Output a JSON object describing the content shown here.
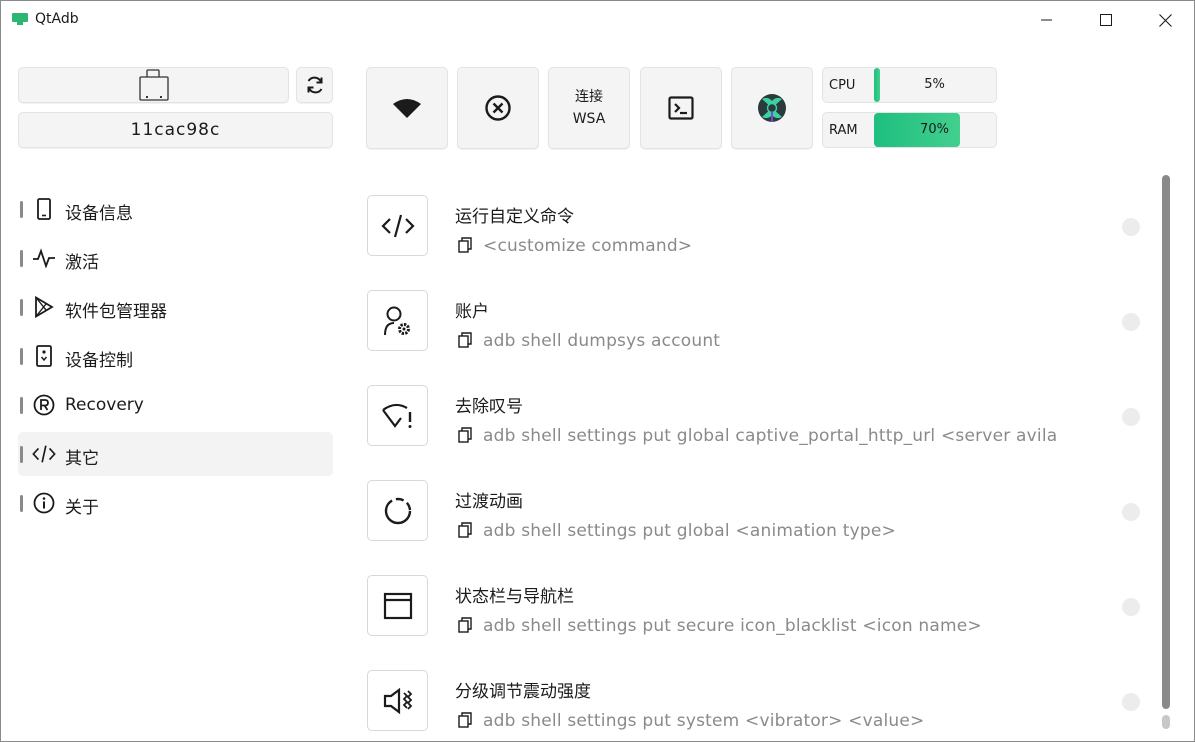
{
  "app": {
    "title": "QtAdb"
  },
  "device": {
    "serial": "11cac98c"
  },
  "toolbar": {
    "wsa_label": "连接\nWSA"
  },
  "meters": {
    "cpu": {
      "label": "CPU",
      "value_text": "5%",
      "value": 0.05
    },
    "ram": {
      "label": "RAM",
      "value_text": "70%",
      "value": 0.7
    }
  },
  "sidebar": {
    "items": [
      {
        "label": "设备信息",
        "icon": "phone-icon"
      },
      {
        "label": "激活",
        "icon": "pulse-icon"
      },
      {
        "label": "软件包管理器",
        "icon": "play-store-icon"
      },
      {
        "label": "设备控制",
        "icon": "remote-icon"
      },
      {
        "label": "Recovery",
        "icon": "registered-icon"
      },
      {
        "label": "其它",
        "icon": "code-icon",
        "active": true
      },
      {
        "label": "关于",
        "icon": "info-icon"
      }
    ]
  },
  "commands": [
    {
      "title": "运行自定义命令",
      "command": "<customize command>",
      "icon": "code-icon"
    },
    {
      "title": "账户",
      "command": "adb shell dumpsys account",
      "icon": "user-settings-icon"
    },
    {
      "title": "去除叹号",
      "command": "adb shell settings put global captive_portal_http_url <server avila",
      "icon": "wifi-warning-icon"
    },
    {
      "title": "过渡动画",
      "command": "adb shell settings put global <animation type>",
      "icon": "loading-circle-icon"
    },
    {
      "title": "状态栏与导航栏",
      "command": "adb shell settings put secure icon_blacklist <icon name>",
      "icon": "window-icon"
    },
    {
      "title": "分级调节震动强度",
      "command": "adb shell settings put system <vibrator> <value>",
      "icon": "vibrate-icon"
    }
  ],
  "colors": {
    "accent": "#1dbf7f",
    "border": "#d8d8d8",
    "muted_text": "#8a8a8a"
  }
}
